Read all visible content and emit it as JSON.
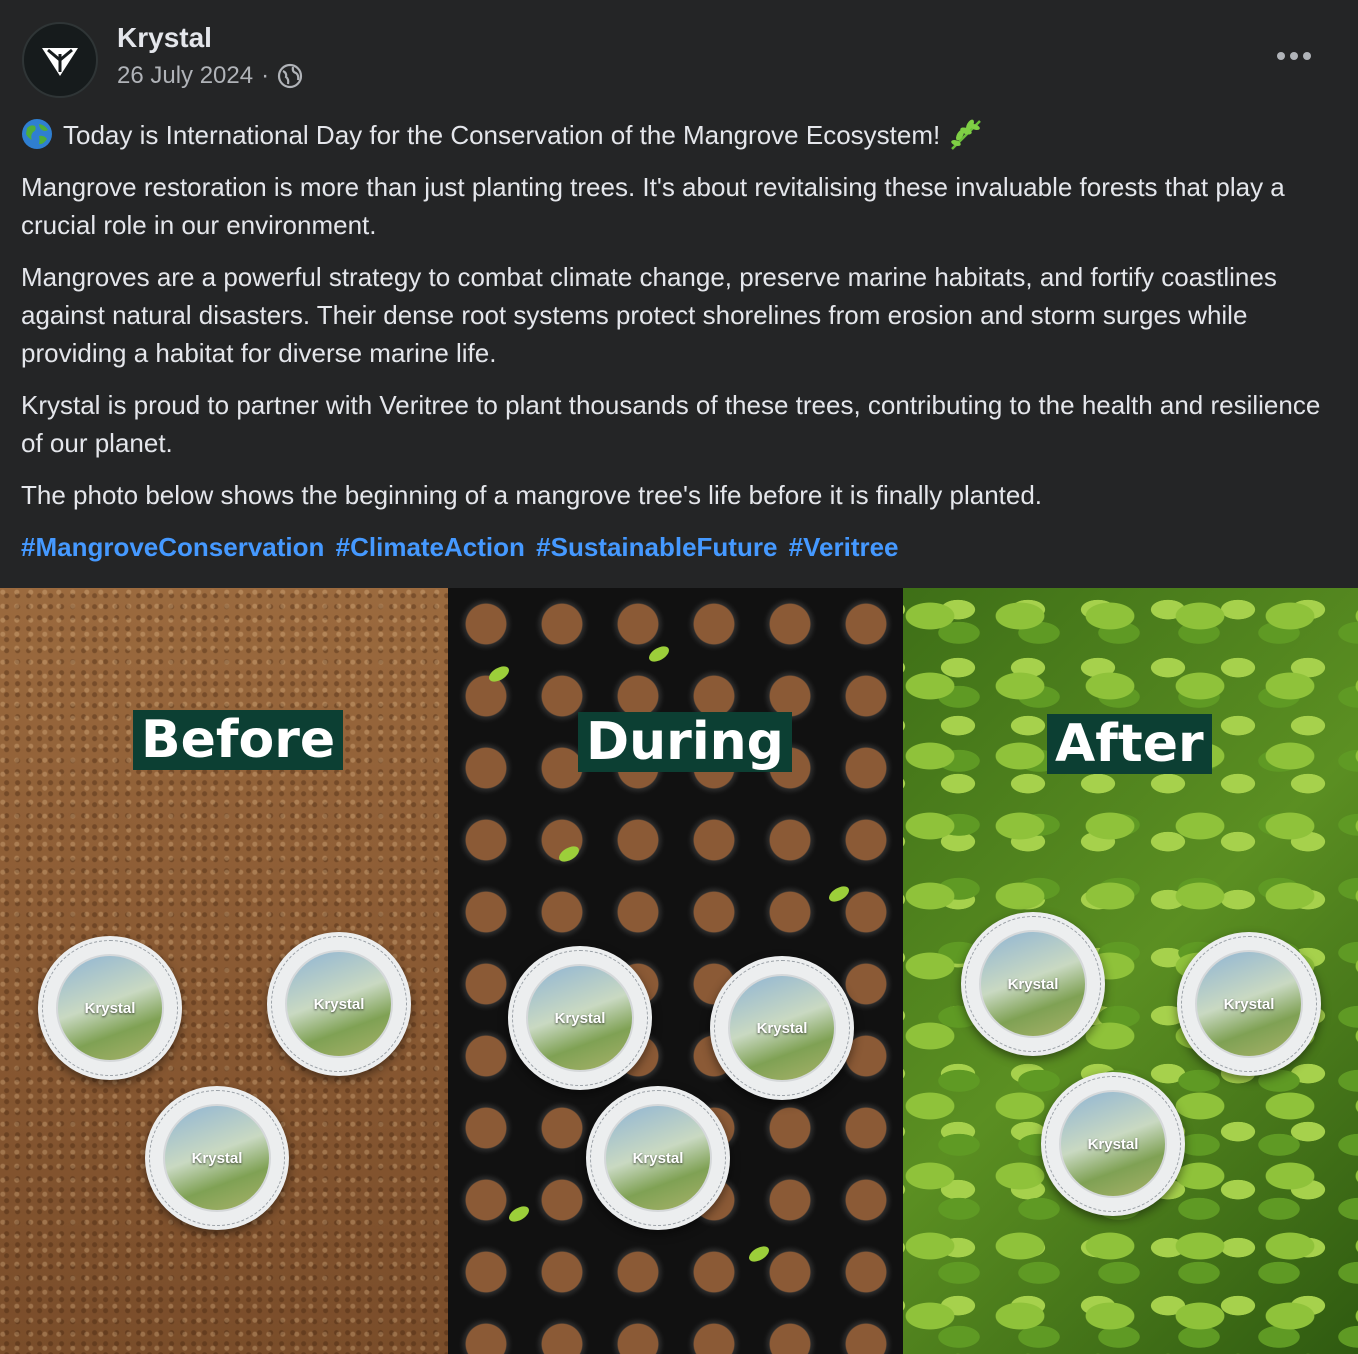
{
  "post": {
    "author": "Krystal",
    "date": "26 July 2024",
    "separator": "·",
    "audience_icon": "globe-icon",
    "more_icon": "more-options-icon"
  },
  "content": {
    "line1": "Today is International Day for the Conservation of the Mangrove Ecosystem!",
    "para2": "Mangrove restoration is more than just planting trees. It's about revitalising these invaluable forests that play a crucial role in our environment.",
    "para3": "Mangroves are a powerful strategy to combat climate change, preserve marine habitats, and fortify coastlines against natural disasters. Their dense root systems protect shorelines from erosion and storm surges while providing a habitat for diverse marine life.",
    "para4": "Krystal is proud to partner with Veritree to plant thousands of these trees, contributing to the health and resilience of our planet.",
    "para5": "The photo below shows the beginning of a mangrove tree's life before it is finally planted.",
    "hashtags": [
      "#MangroveConservation",
      "#ClimateAction",
      "#SustainableFuture",
      "#Veritree"
    ]
  },
  "photo": {
    "labels": [
      "Before",
      "During",
      "After"
    ],
    "badge_brand": "Krystal"
  },
  "colors": {
    "background": "#242526",
    "text": "#e4e6eb",
    "secondary_text": "#b0b3b8",
    "hashtag": "#4599ff",
    "label_bg": "#0c3f33"
  }
}
